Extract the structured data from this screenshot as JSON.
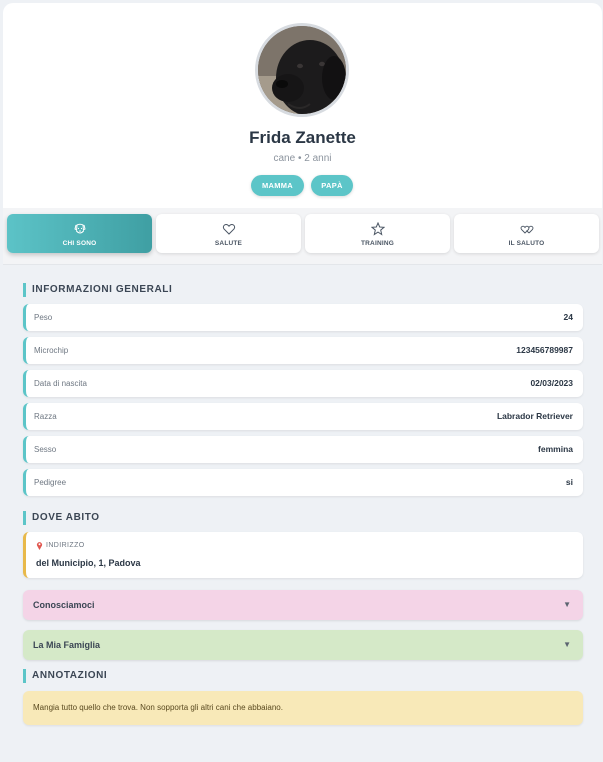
{
  "profile": {
    "name": "Frida Zanette",
    "subtitle": "cane • 2 anni",
    "pills": [
      "MAMMA",
      "PAPÀ"
    ]
  },
  "tabs": [
    {
      "label": "CHI SONO",
      "icon": "dog-face-icon",
      "active": true
    },
    {
      "label": "SALUTE",
      "icon": "heart-icon",
      "active": false
    },
    {
      "label": "TRAINING",
      "icon": "star-icon",
      "active": false
    },
    {
      "label": "IL SALUTO",
      "icon": "hearts-icon",
      "active": false
    }
  ],
  "general": {
    "title": "INFORMAZIONI GENERALI",
    "rows": [
      {
        "label": "Peso",
        "value": "24"
      },
      {
        "label": "Microchip",
        "value": "123456789987"
      },
      {
        "label": "Data di nascita",
        "value": "02/03/2023"
      },
      {
        "label": "Razza",
        "value": "Labrador Retriever"
      },
      {
        "label": "Sesso",
        "value": "femmina"
      },
      {
        "label": "Pedigree",
        "value": "si"
      }
    ]
  },
  "home": {
    "title": "DOVE ABITO",
    "address_label": "INDIRIZZO",
    "address_value": "del Municipio, 1, Padova"
  },
  "accordions": [
    {
      "label": "Conosciamoci",
      "arrow": "▼",
      "color": "#f4d4e7"
    },
    {
      "label": "La Mia Famiglia",
      "arrow": "▼",
      "color": "#d5e9c8"
    }
  ],
  "notes": {
    "title": "ANNOTAZIONI",
    "text": "Mangia tutto quello che trova. Non sopporta gli altri cani che abbaiano."
  },
  "colors": {
    "accent": "#5cc5c8",
    "address_border": "#e8b94a",
    "notes_bg": "#f8e9b8"
  }
}
